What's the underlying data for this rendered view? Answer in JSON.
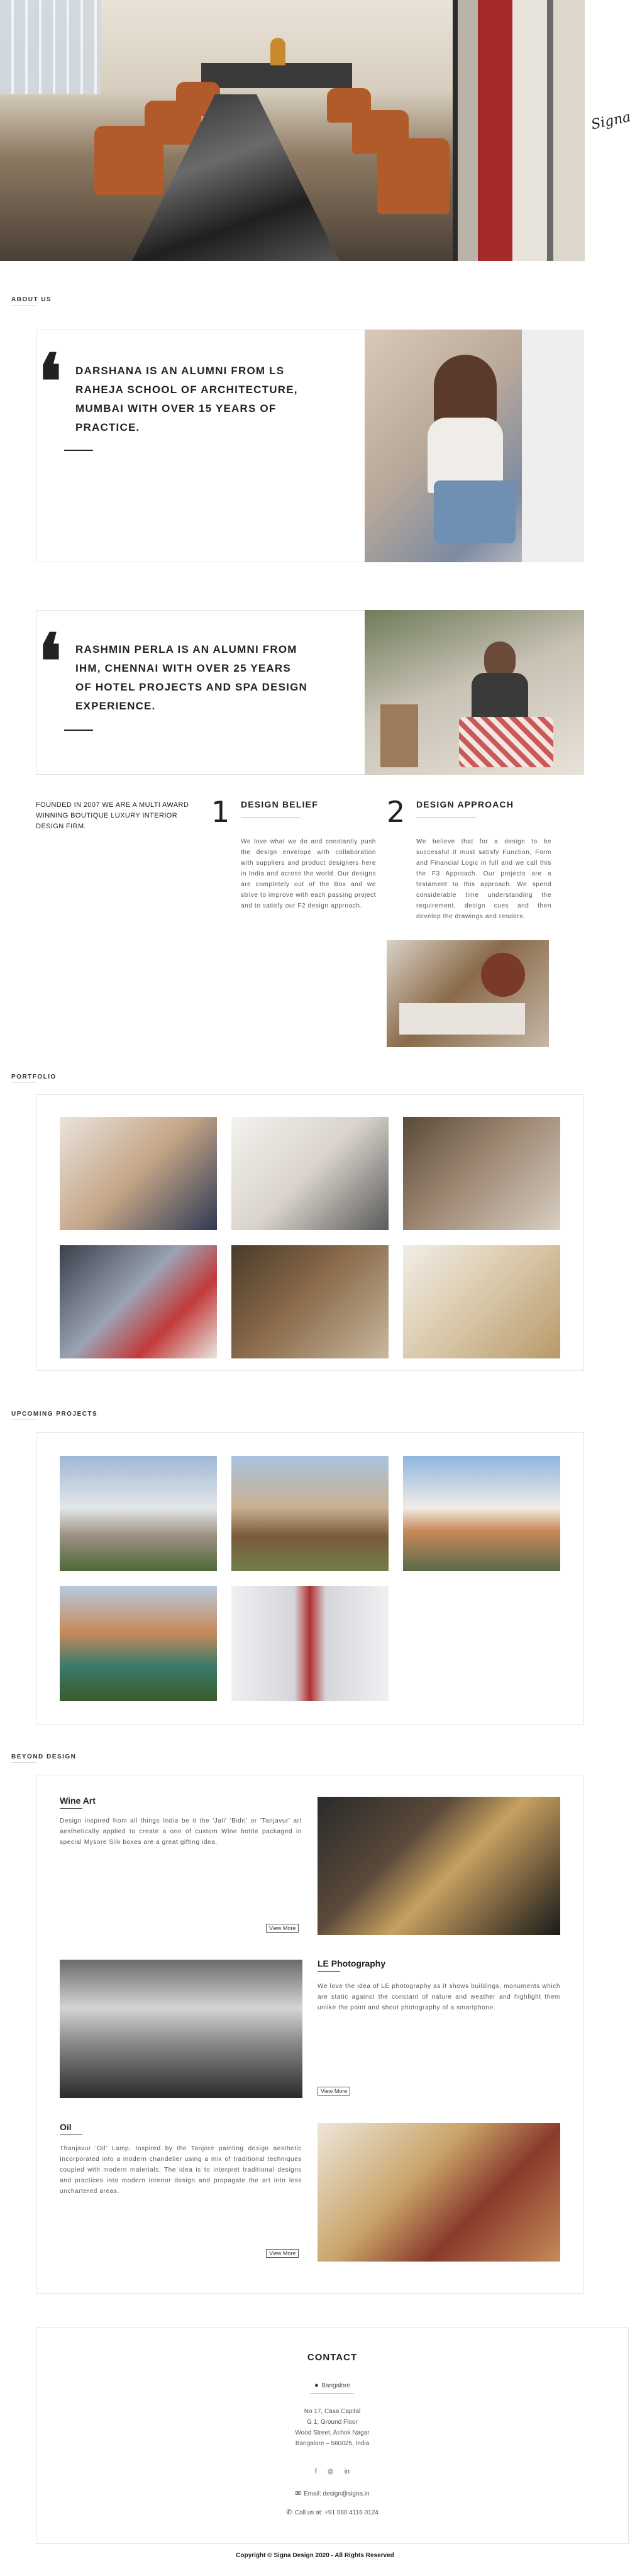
{
  "hero": {
    "signature": "Signa"
  },
  "about": {
    "label": "ABOUT US",
    "quote1": "DARSHANA IS AN ALUMNI FROM LS RAHEJA SCHOOL OF ARCHITECTURE, MUMBAI WITH OVER 15 YEARS OF PRACTICE.",
    "quote2": "RASHMIN PERLA IS AN ALUMNI FROM IHM, CHENNAI WITH OVER 25 YEARS OF HOTEL PROJECTS AND SPA DESIGN EXPERIENCE.",
    "founded": "FOUNDED IN 2007 WE ARE A MULTI AWARD WINNING BOUTIQUE LUXURY INTERIOR DESIGN FIRM.",
    "belief": {
      "num": "1",
      "title": "DESIGN BELIEF",
      "text": "We love what we do and constantly push the design envelope with collaboration with suppliers and product designers here in India and across the world. Our designs are completely out of the Box and we strive to improve with each passing project and to satisfy our F2 design approach."
    },
    "approach": {
      "num": "2",
      "title": "DESIGN APPROACH",
      "text": "We believe that for a design to be successful it must satisfy Function, Form and Financial Logic in full and we call this the F3 Approach. Our projects are a testament to this approach. We spend considerable time understanding the requirement, design cues and then develop the drawings and renders."
    }
  },
  "portfolio": {
    "label": "PORTFOLIO"
  },
  "upcoming": {
    "label": "UPCOMING PROJECTS"
  },
  "beyond": {
    "label": "BEYOND DESIGN",
    "items": [
      {
        "title": "Wine Art",
        "text": "Design inspired from all things India be it the 'Jali' 'Bidri' or 'Tanjavur' art aesthetically applied to create a one of custom Wine bottle packaged in special Mysore Silk boxes are a great gifting idea.",
        "button": "View More"
      },
      {
        "title": "LE Photography",
        "text": "We love the idea of LE photography as it shows buildings, monuments which are static against the constant of nature and weather and highlight them unlike the point and shoot photography of a smartphone.",
        "button": "View More"
      },
      {
        "title": "Oil",
        "text": "Thanjavur 'Oil' Lamp, Inspired by the Tanjore painting design aesthetic Incorporated into a modern chandelier using a mix of traditional techniques coupled with modern materials. The idea is to interpret traditional designs and practices into modern interior design and propagate the art into less unchartered areas.",
        "button": "View More"
      }
    ]
  },
  "contact": {
    "title": "CONTACT",
    "city": "Bangalore",
    "address": [
      "No 17, Casa Capital",
      "G 1, Ground Floor",
      "Wood Street, Ashok Nagar",
      "Bangalore – 560025, India"
    ],
    "email": "Email: design@signa.in",
    "phone": "Call us at: +91 080 4116 0124",
    "social": [
      "f",
      "◎",
      "in"
    ]
  },
  "footer": {
    "copyright": "Copyright © Signa Design 2020 - All Rights Reserved"
  }
}
